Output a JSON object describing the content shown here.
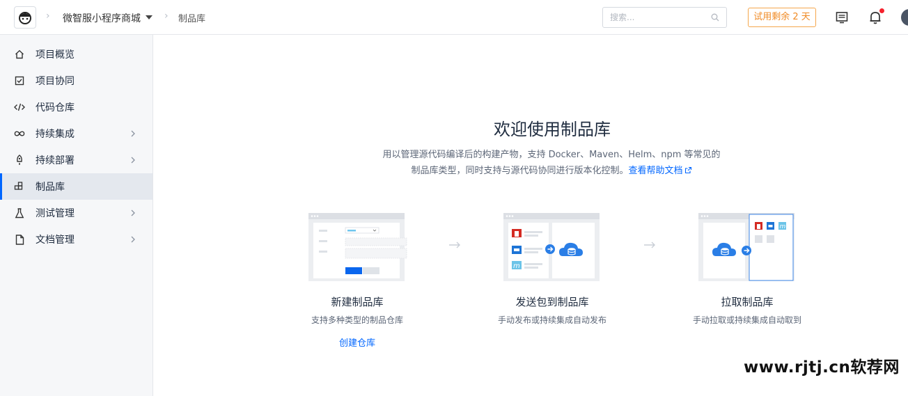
{
  "header": {
    "project_name": "微智服小程序商城",
    "crumb_current": "制品库",
    "search_placeholder": "搜索...",
    "trial_label": "试用剩余 2 天"
  },
  "sidebar": {
    "items": [
      {
        "label": "项目概览",
        "icon": "home-icon"
      },
      {
        "label": "项目协同",
        "icon": "checkbox-icon"
      },
      {
        "label": "代码仓库",
        "icon": "code-icon"
      },
      {
        "label": "持续集成",
        "icon": "infinity-icon"
      },
      {
        "label": "持续部署",
        "icon": "rocket-icon"
      },
      {
        "label": "制品库",
        "icon": "artifact-icon"
      },
      {
        "label": "测试管理",
        "icon": "flask-icon"
      },
      {
        "label": "文档管理",
        "icon": "document-icon"
      }
    ]
  },
  "main": {
    "title": "欢迎使用制品库",
    "desc_line1": "用以管理源代码编译后的构建产物，支持 Docker、Maven、Helm、npm 等常见的",
    "desc_line2": "制品库类型，同时支持与源代码协同进行版本化控制。",
    "help_link": "查看帮助文档",
    "cards": [
      {
        "title": "新建制品库",
        "desc": "支持多种类型的制品仓库",
        "link": "创建仓库"
      },
      {
        "title": "发送包到制品库",
        "desc": "手动发布或持续集成自动发布"
      },
      {
        "title": "拉取制品库",
        "desc": "手动拉取或持续集成自动取到"
      }
    ]
  },
  "watermark": "www.rjtj.cn软荐网",
  "colors": {
    "accent": "#0066ff",
    "trial": "#f08a24",
    "sidebar_bg": "#f6f7f9",
    "badge": "#f5222d"
  }
}
